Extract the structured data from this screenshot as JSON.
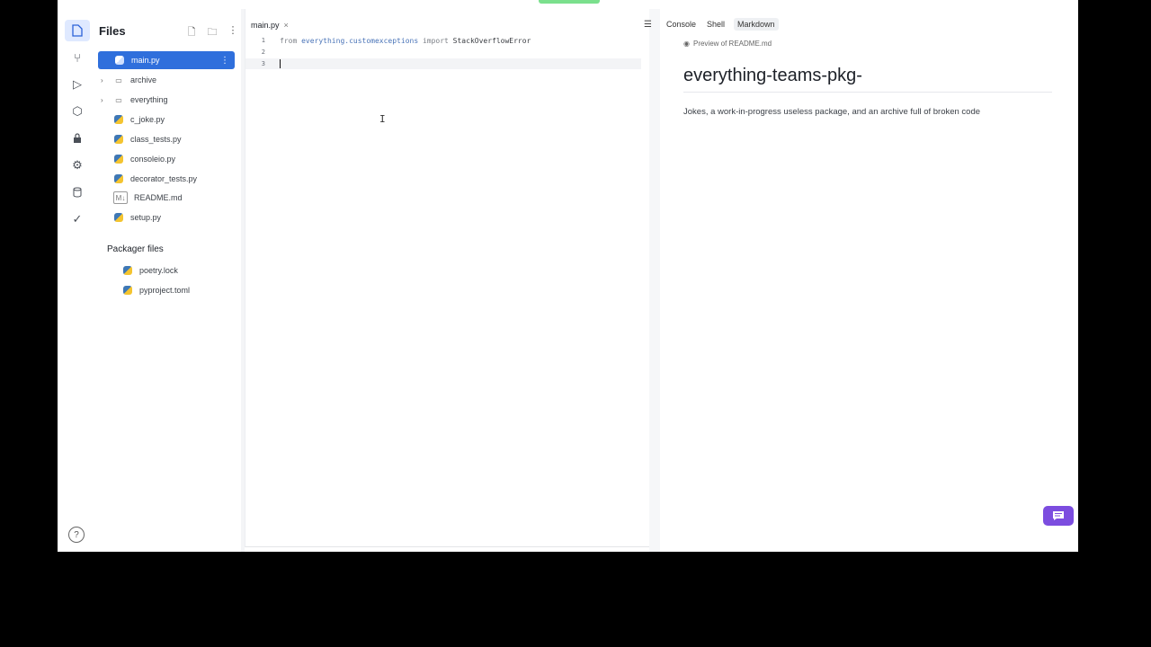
{
  "files_pane": {
    "title": "Files",
    "new_file_icon": "new-file-icon",
    "new_folder_icon": "new-folder-icon",
    "more_icon": "kebab-icon",
    "items": [
      {
        "label": "main.py",
        "type": "python",
        "selected": true
      },
      {
        "label": "archive",
        "type": "folder"
      },
      {
        "label": "everything",
        "type": "folder"
      },
      {
        "label": "c_joke.py",
        "type": "python"
      },
      {
        "label": "class_tests.py",
        "type": "python"
      },
      {
        "label": "consoleio.py",
        "type": "python"
      },
      {
        "label": "decorator_tests.py",
        "type": "python"
      },
      {
        "label": "README.md",
        "type": "markdown"
      },
      {
        "label": "setup.py",
        "type": "python"
      }
    ],
    "packager_title": "Packager files",
    "packager_items": [
      {
        "label": "poetry.lock"
      },
      {
        "label": "pyproject.toml"
      }
    ]
  },
  "editor": {
    "tab_label": "main.py",
    "tab_close": "×",
    "lines": [
      {
        "n": "1",
        "kw1": "from ",
        "module": "everything.customexceptions",
        "kw2": " import ",
        "name": "StackOverflowError"
      },
      {
        "n": "2"
      },
      {
        "n": "3"
      }
    ]
  },
  "right_pane": {
    "tabs": [
      "Console",
      "Shell",
      "Markdown"
    ],
    "active_tab": "Markdown",
    "preview_label": "Preview of README.md",
    "md_heading": "everything-teams-pkg-",
    "md_paragraph": "Jokes, a work-in-progress useless package, and an archive full of broken code"
  },
  "colors": {
    "accent": "#2f6fdc",
    "chat_button": "#7c4ddf",
    "run_indicator": "#7be08d"
  }
}
